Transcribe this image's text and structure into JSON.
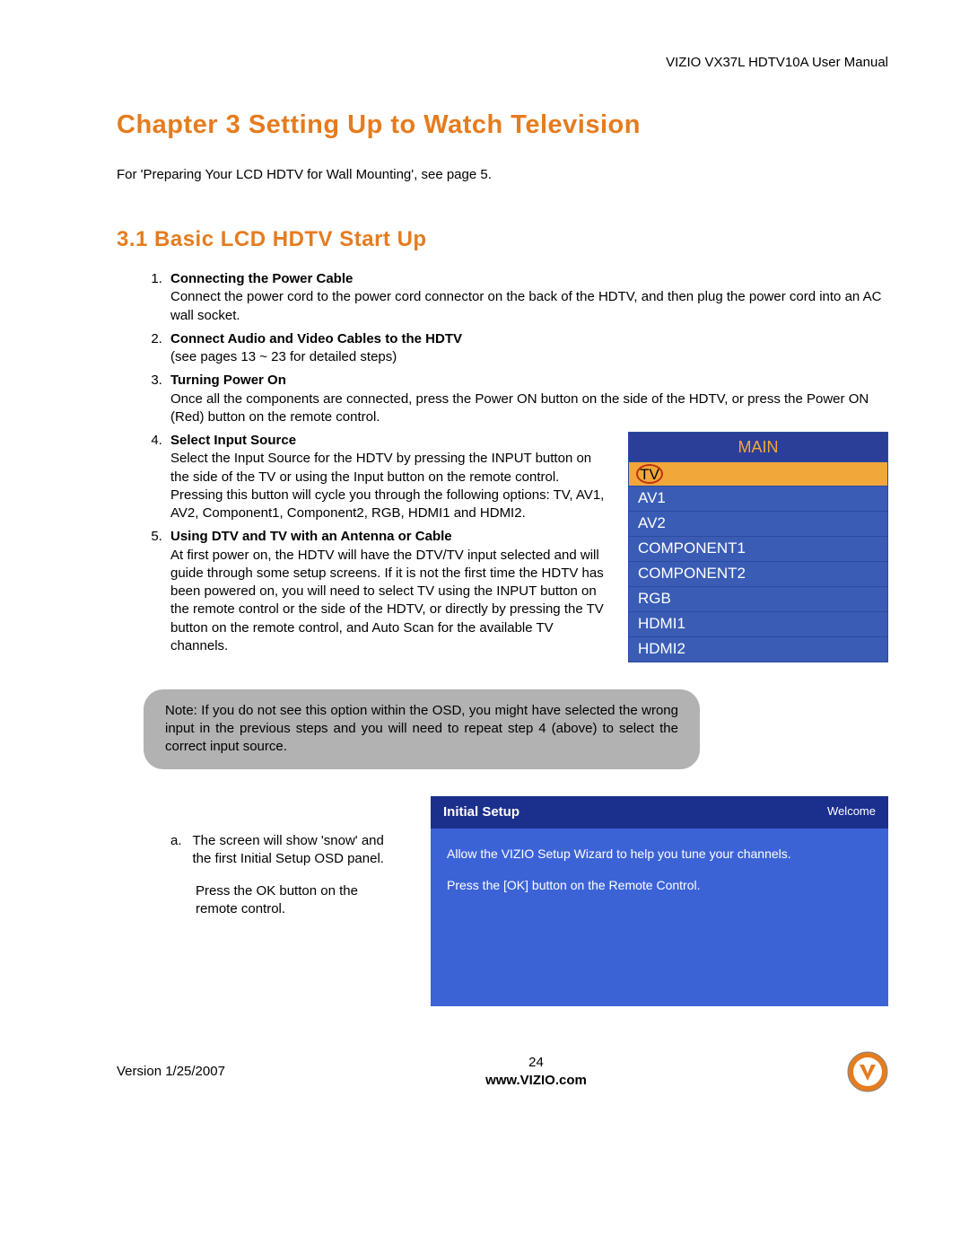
{
  "header": {
    "doc_title": "VIZIO VX37L HDTV10A User Manual"
  },
  "chapter": {
    "title": "Chapter 3 Setting Up to Watch Television"
  },
  "intro": "For 'Preparing Your LCD HDTV for Wall Mounting', see page 5.",
  "section": {
    "title": "3.1 Basic LCD HDTV Start Up"
  },
  "steps": [
    {
      "title": "Connecting the Power Cable",
      "body": "Connect the power cord to the power cord connector on the back of the HDTV, and then plug the power cord into an AC wall socket."
    },
    {
      "title": "Connect Audio and Video Cables to the HDTV",
      "body": "(see pages 13 ~ 23 for detailed steps)"
    },
    {
      "title": "Turning Power On",
      "body": "Once all the components are connected, press the Power ON button on the side of the HDTV, or press the Power ON (Red) button on the remote control."
    },
    {
      "title": "Select Input Source",
      "body": "Select the Input Source for the HDTV by pressing the INPUT button on the side of the TV or using the Input button on the remote control.  Pressing this button will cycle you through the following options: TV, AV1, AV2, Component1, Component2, RGB, HDMI1 and HDMI2."
    },
    {
      "title": "Using DTV and TV with an Antenna or Cable",
      "body": "At first power on, the HDTV will have the DTV/TV input selected and will guide through some setup screens.  If it is not the first time the HDTV has been powered on, you will need to select TV using the INPUT button on the remote control or the side of the HDTV, or directly by pressing the TV button on the remote control, and Auto Scan for the available TV channels."
    }
  ],
  "main_menu": {
    "header": "MAIN",
    "selected": "TV",
    "items": [
      "AV1",
      "AV2",
      "COMPONENT1",
      "COMPONENT2",
      "RGB",
      "HDMI1",
      "HDMI2"
    ]
  },
  "note": "Note: If you do not see this option within the OSD, you might have selected the wrong input in the previous steps and you will need to repeat step 4 (above) to select the correct input source.",
  "sub_a": {
    "marker": "a.",
    "line1": "The screen will show 'snow' and the first Initial Setup OSD panel.",
    "line2": "Press the OK button on the remote control."
  },
  "setup_panel": {
    "title": "Initial  Setup",
    "welcome": "Welcome",
    "p1": "Allow the VIZIO Setup Wizard to help you tune your channels.",
    "p2": "Press the [OK] button on the Remote Control."
  },
  "footer": {
    "version": "Version 1/25/2007",
    "page": "24",
    "url": "www.VIZIO.com"
  }
}
